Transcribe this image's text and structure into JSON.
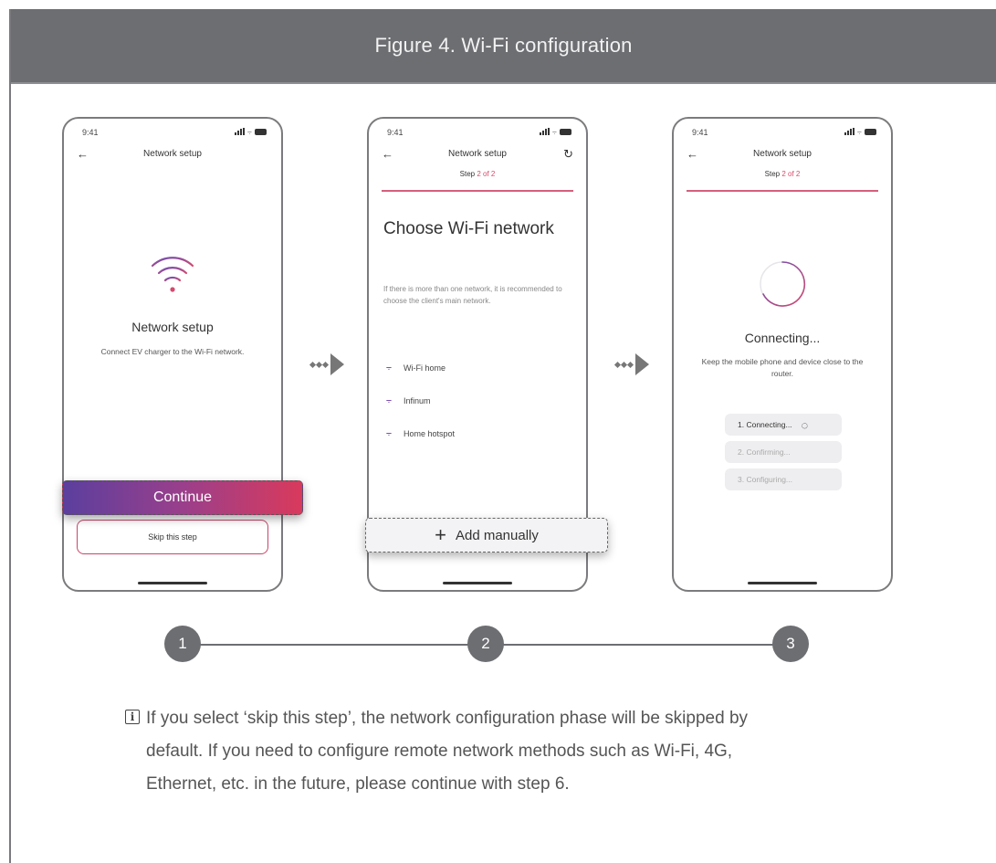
{
  "header": {
    "title": "Figure 4. Wi-Fi configuration"
  },
  "status_time": "9:41",
  "screen1": {
    "nav_title": "Network setup",
    "title": "Network setup",
    "subtitle": "Connect EV charger to the Wi-Fi network.",
    "continue_label": "Continue",
    "skip_label": "Skip this step"
  },
  "screen2": {
    "nav_title": "Network setup",
    "step_prefix": "Step",
    "step_value": "2 of 2",
    "heading": "Choose Wi-Fi network",
    "description": "If there is more than one network, it is recommended to choose the client's main network.",
    "networks": [
      "Wi-Fi home",
      "Infinum",
      "Home hotspot"
    ],
    "add_label": "Add manually"
  },
  "screen3": {
    "nav_title": "Network setup",
    "step_prefix": "Step",
    "step_value": "2 of 2",
    "title": "Connecting...",
    "subtitle": "Keep the mobile phone and device close to the router.",
    "progress": [
      "1. Connecting...",
      "2. Confirming...",
      "3. Configuring..."
    ]
  },
  "steps": [
    "1",
    "2",
    "3"
  ],
  "info": {
    "line1": "If you select ‘skip this step’, the network configuration phase will be skipped by",
    "line2": "default. If you need to configure remote network methods such as Wi-Fi, 4G,",
    "line3": "Ethernet, etc. in the future, please continue with step 6."
  },
  "colors": {
    "header_bg": "#6d6e72",
    "accent_pink": "#d4607c",
    "accent_purple": "#7a4fb3"
  }
}
